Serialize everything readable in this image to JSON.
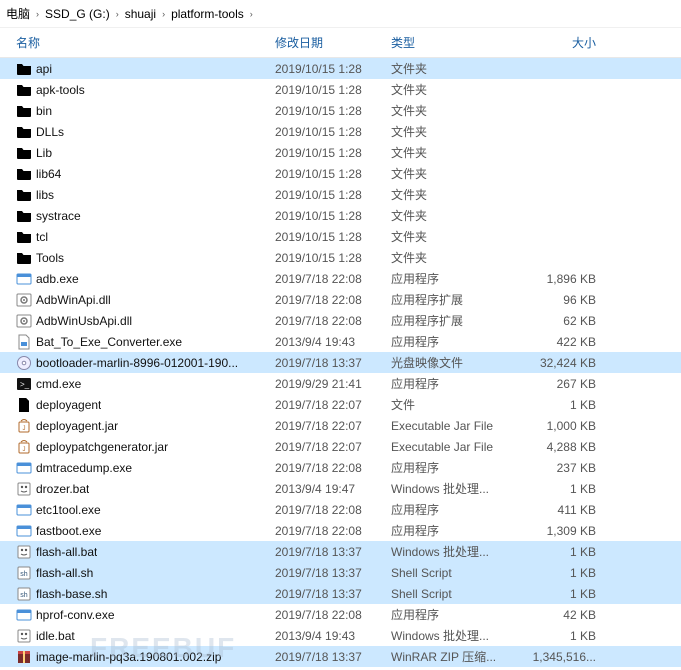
{
  "breadcrumb": [
    "电脑",
    "SSD_G (G:)",
    "shuaji",
    "platform-tools"
  ],
  "columns": {
    "name": "名称",
    "date": "修改日期",
    "type": "类型",
    "size": "大小"
  },
  "watermark": "FREEBUF",
  "files": [
    {
      "name": "api",
      "date": "2019/10/15 1:28",
      "type": "文件夹",
      "size": "",
      "icon": "folder",
      "selected": true
    },
    {
      "name": "apk-tools",
      "date": "2019/10/15 1:28",
      "type": "文件夹",
      "size": "",
      "icon": "folder",
      "selected": false
    },
    {
      "name": "bin",
      "date": "2019/10/15 1:28",
      "type": "文件夹",
      "size": "",
      "icon": "folder",
      "selected": false
    },
    {
      "name": "DLLs",
      "date": "2019/10/15 1:28",
      "type": "文件夹",
      "size": "",
      "icon": "folder",
      "selected": false
    },
    {
      "name": "Lib",
      "date": "2019/10/15 1:28",
      "type": "文件夹",
      "size": "",
      "icon": "folder",
      "selected": false
    },
    {
      "name": "lib64",
      "date": "2019/10/15 1:28",
      "type": "文件夹",
      "size": "",
      "icon": "folder",
      "selected": false
    },
    {
      "name": "libs",
      "date": "2019/10/15 1:28",
      "type": "文件夹",
      "size": "",
      "icon": "folder",
      "selected": false
    },
    {
      "name": "systrace",
      "date": "2019/10/15 1:28",
      "type": "文件夹",
      "size": "",
      "icon": "folder",
      "selected": false
    },
    {
      "name": "tcl",
      "date": "2019/10/15 1:28",
      "type": "文件夹",
      "size": "",
      "icon": "folder",
      "selected": false
    },
    {
      "name": "Tools",
      "date": "2019/10/15 1:28",
      "type": "文件夹",
      "size": "",
      "icon": "folder",
      "selected": false
    },
    {
      "name": "adb.exe",
      "date": "2019/7/18 22:08",
      "type": "应用程序",
      "size": "1,896 KB",
      "icon": "app",
      "selected": false
    },
    {
      "name": "AdbWinApi.dll",
      "date": "2019/7/18 22:08",
      "type": "应用程序扩展",
      "size": "96 KB",
      "icon": "gear",
      "selected": false
    },
    {
      "name": "AdbWinUsbApi.dll",
      "date": "2019/7/18 22:08",
      "type": "应用程序扩展",
      "size": "62 KB",
      "icon": "gear",
      "selected": false
    },
    {
      "name": "Bat_To_Exe_Converter.exe",
      "date": "2013/9/4 19:43",
      "type": "应用程序",
      "size": "422 KB",
      "icon": "fileapp",
      "selected": false
    },
    {
      "name": "bootloader-marlin-8996-012001-190...",
      "date": "2019/7/18 13:37",
      "type": "光盘映像文件",
      "size": "32,424 KB",
      "icon": "disc",
      "selected": true
    },
    {
      "name": "cmd.exe",
      "date": "2019/9/29 21:41",
      "type": "应用程序",
      "size": "267 KB",
      "icon": "cmd",
      "selected": false
    },
    {
      "name": "deployagent",
      "date": "2019/7/18 22:07",
      "type": "文件",
      "size": "1 KB",
      "icon": "file",
      "selected": false
    },
    {
      "name": "deployagent.jar",
      "date": "2019/7/18 22:07",
      "type": "Executable Jar File",
      "size": "1,000 KB",
      "icon": "jar",
      "selected": false
    },
    {
      "name": "deploypatchgenerator.jar",
      "date": "2019/7/18 22:07",
      "type": "Executable Jar File",
      "size": "4,288 KB",
      "icon": "jar",
      "selected": false
    },
    {
      "name": "dmtracedump.exe",
      "date": "2019/7/18 22:08",
      "type": "应用程序",
      "size": "237 KB",
      "icon": "app",
      "selected": false
    },
    {
      "name": "drozer.bat",
      "date": "2013/9/4 19:47",
      "type": "Windows 批处理...",
      "size": "1 KB",
      "icon": "bat",
      "selected": false
    },
    {
      "name": "etc1tool.exe",
      "date": "2019/7/18 22:08",
      "type": "应用程序",
      "size": "411 KB",
      "icon": "app",
      "selected": false
    },
    {
      "name": "fastboot.exe",
      "date": "2019/7/18 22:08",
      "type": "应用程序",
      "size": "1,309 KB",
      "icon": "app",
      "selected": false
    },
    {
      "name": "flash-all.bat",
      "date": "2019/7/18 13:37",
      "type": "Windows 批处理...",
      "size": "1 KB",
      "icon": "bat",
      "selected": true
    },
    {
      "name": "flash-all.sh",
      "date": "2019/7/18 13:37",
      "type": "Shell Script",
      "size": "1 KB",
      "icon": "sh",
      "selected": true
    },
    {
      "name": "flash-base.sh",
      "date": "2019/7/18 13:37",
      "type": "Shell Script",
      "size": "1 KB",
      "icon": "sh",
      "selected": true
    },
    {
      "name": "hprof-conv.exe",
      "date": "2019/7/18 22:08",
      "type": "应用程序",
      "size": "42 KB",
      "icon": "app",
      "selected": false
    },
    {
      "name": "idle.bat",
      "date": "2013/9/4 19:43",
      "type": "Windows 批处理...",
      "size": "1 KB",
      "icon": "bat",
      "selected": false
    },
    {
      "name": "image-marlin-pq3a.190801.002.zip",
      "date": "2019/7/18 13:37",
      "type": "WinRAR ZIP 压缩...",
      "size": "1,345,516...",
      "icon": "zip",
      "selected": true
    }
  ]
}
